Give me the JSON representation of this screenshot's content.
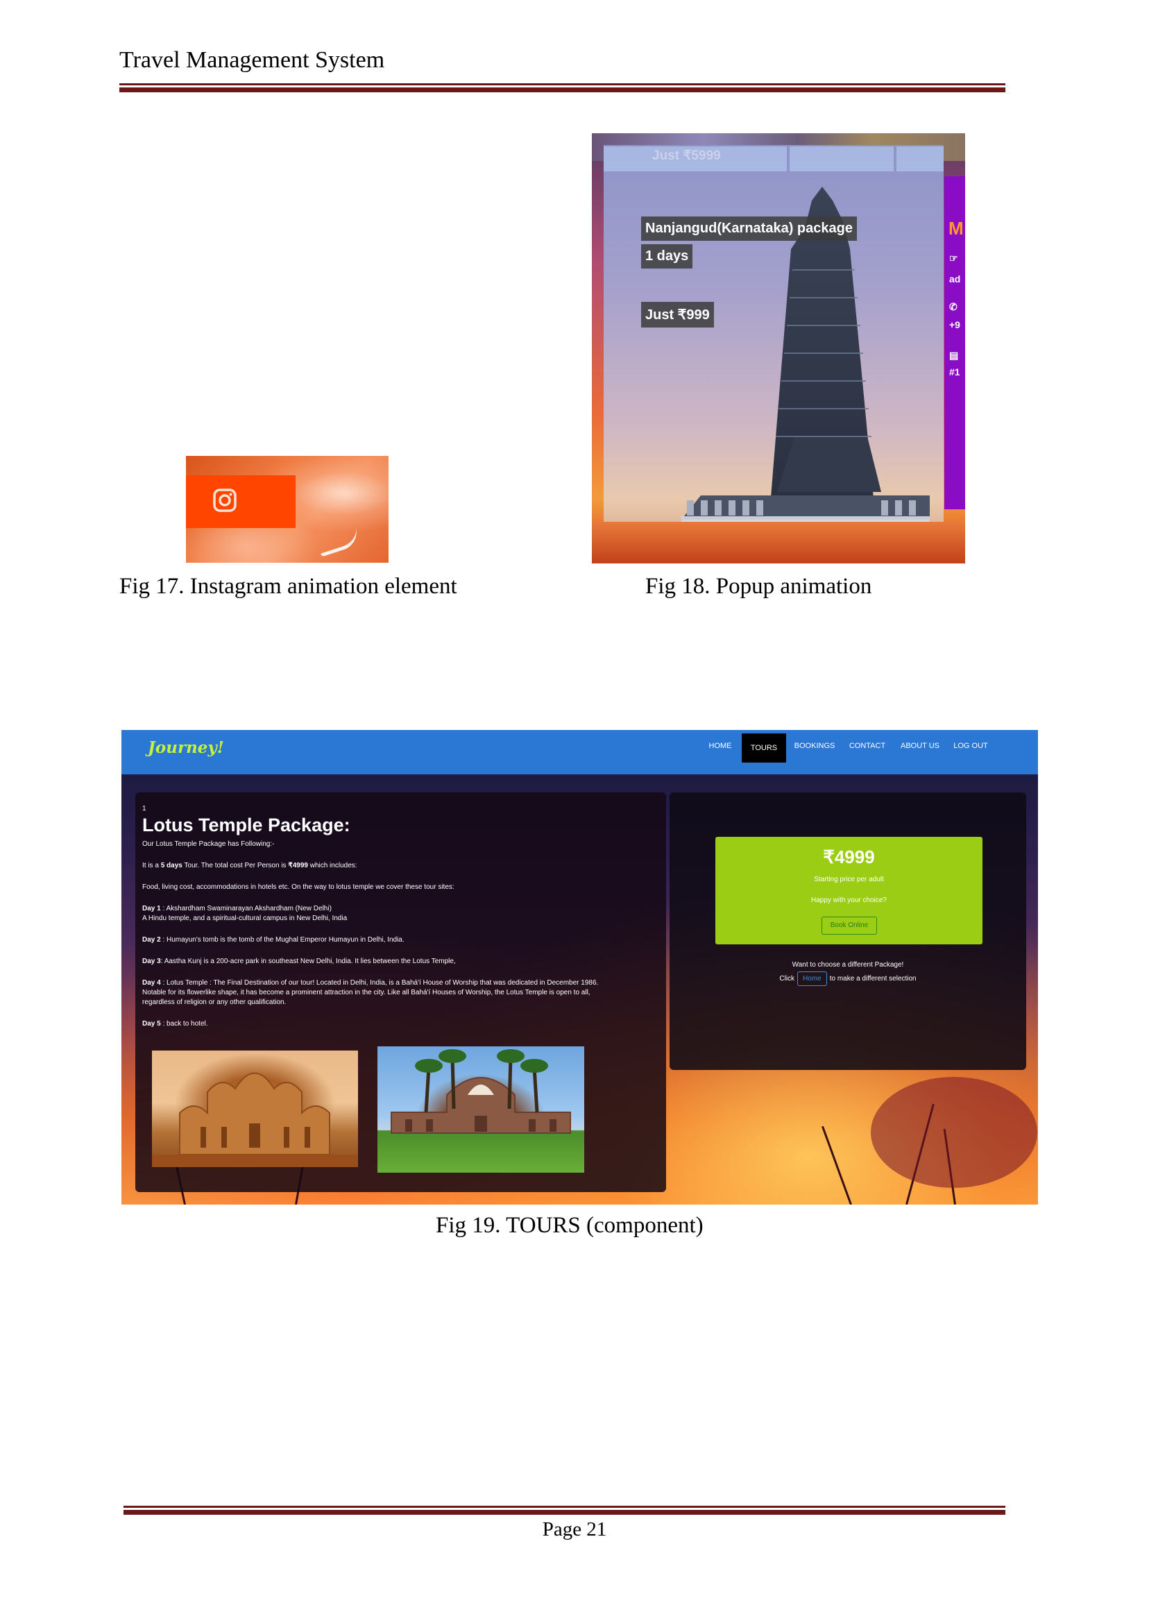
{
  "header": {
    "title": "Travel Management System"
  },
  "captions": {
    "fig17": "Fig 17. Instagram animation element",
    "fig18": "Fig 18. Popup animation",
    "fig19": "Fig 19. TOURS (component)"
  },
  "fig17": {
    "icon": "instagram-icon",
    "accent_color": "#ff4500"
  },
  "fig18": {
    "top_price": "Just ₹5999",
    "package_name": "Nanjangud(Karnataka) package",
    "duration": "1 days",
    "price": "Just ₹999",
    "side_panel": {
      "heading_letter": "M",
      "line1": "ad",
      "line2": "+9",
      "line3": "#1"
    },
    "side_color": "#8a0dc5"
  },
  "fig19": {
    "brand": "Journey!",
    "nav": [
      "HOME",
      "TOURS",
      "BOOKINGS",
      "CONTACT",
      "ABOUT US",
      "LOG OUT"
    ],
    "active_nav": "TOURS",
    "package": {
      "number": "1",
      "title": "Lotus Temple Package:",
      "intro": "Our Lotus Temple Package has Following:-",
      "cost_prefix": "It is a ",
      "cost_days": "5 days",
      "cost_mid": " Tour. The total cost Per Person is ",
      "cost_price": "₹4999",
      "cost_suffix": " which includes:",
      "food": "Food, living cost, accommodations in hotels etc. On the way to lotus temple we cover these tour sites:",
      "days": [
        {
          "label": "Day 1",
          "text": " : Akshardham Swaminarayan Akshardham (New Delhi)",
          "text2": "A Hindu temple, and a spiritual-cultural campus in New Delhi, India"
        },
        {
          "label": "Day 2",
          "text": " : Humayun's tomb is the tomb of the Mughal Emperor Humayun in Delhi, India."
        },
        {
          "label": "Day 3",
          "text": ": Aastha Kunj is a 200-acre park in southeast New Delhi, India. It lies between the Lotus Temple,"
        },
        {
          "label": "Day 4",
          "text": " : Lotus Temple : The Final Destination of our tour! Located in Delhi, India, is a Bahá'í House of Worship that was dedicated in December 1986.",
          "text2": "Notable for its flowerlike shape, it has become a prominent attraction in the city. Like all Bahá'í Houses of Worship, the Lotus Temple is open to all,",
          "text3": "regardless of religion or any other qualification."
        },
        {
          "label": "Day 5",
          "text": " : back to hotel."
        }
      ]
    },
    "price_card": {
      "price": "₹4999",
      "starting": "Starting price per adult",
      "happy": "Happy with your choice?",
      "book": "Book Online"
    },
    "choose": "Want to choose a different Package!",
    "click": "Click",
    "home_btn": "Home",
    "after_home": "to make a different selection",
    "nav_color": "#2b78d4",
    "card_color": "#9acd14"
  },
  "footer": {
    "page": "Page 21"
  }
}
